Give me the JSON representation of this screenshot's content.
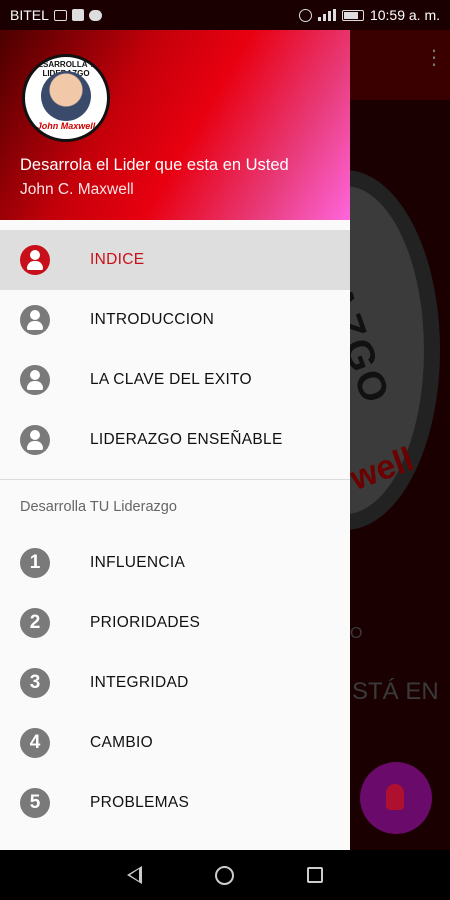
{
  "status_bar": {
    "carrier": "BITEL",
    "time": "10:59 a. m.",
    "left_icons": [
      "laptop-icon",
      "facebook-icon",
      "chat-icon"
    ],
    "right_icons": [
      "alarm-icon",
      "signal-icon",
      "battery-icon"
    ]
  },
  "drawer": {
    "header": {
      "avatar_text_top": "DESARROLLA TU LIDERAZGO",
      "avatar_text_bottom": "John Maxwell",
      "title": "Desarrola el Lider que esta en Usted",
      "subtitle": "John C. Maxwell"
    },
    "main_items": [
      {
        "label": "INDICE",
        "icon": "person-icon",
        "active": true
      },
      {
        "label": "INTRODUCCION",
        "icon": "person-icon",
        "active": false
      },
      {
        "label": "LA CLAVE DEL EXITO",
        "icon": "person-icon",
        "active": false
      },
      {
        "label": "LIDERAZGO ENSEÑABLE",
        "icon": "person-icon",
        "active": false
      }
    ],
    "section_title": "Desarrolla TU Liderazgo",
    "chapter_items": [
      {
        "number": "1",
        "label": "INFLUENCIA"
      },
      {
        "number": "2",
        "label": "PRIORIDADES"
      },
      {
        "number": "3",
        "label": "INTEGRIDAD"
      },
      {
        "number": "4",
        "label": "CAMBIO"
      },
      {
        "number": "5",
        "label": "PROBLEMAS"
      }
    ]
  },
  "background": {
    "circle_text": "RAZGO",
    "circle_red_text": "well",
    "text1": "O",
    "text2": "STÁ EN"
  },
  "colors": {
    "accent": "#c8101a",
    "icon_gray": "#7a7a7a"
  }
}
